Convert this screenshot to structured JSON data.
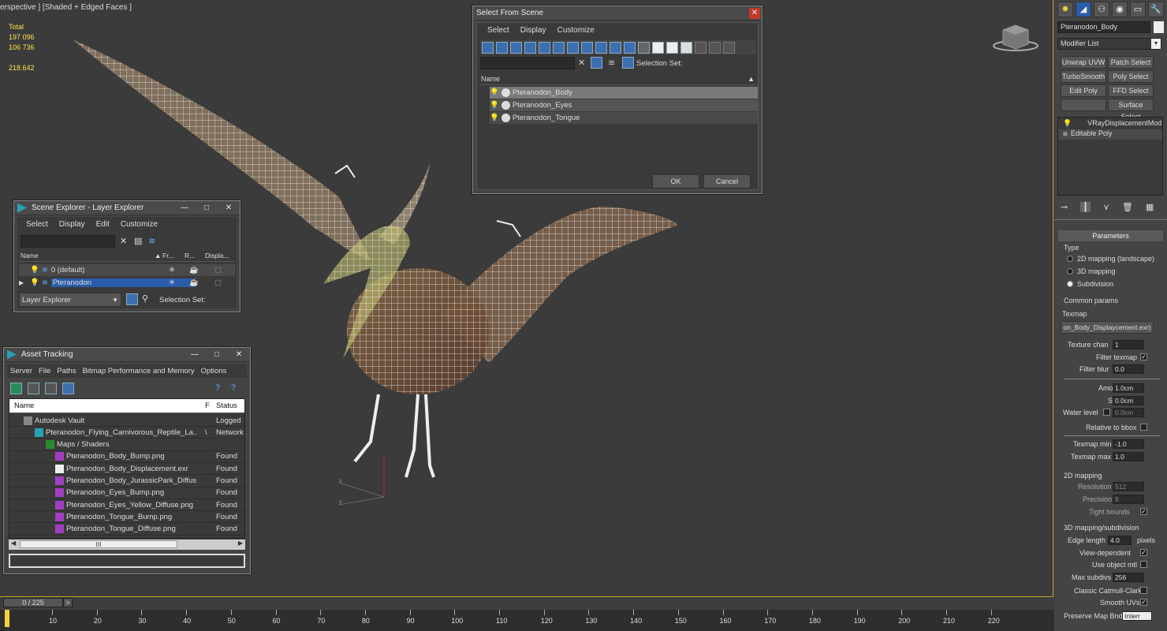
{
  "viewport": {
    "label": "erspective ] [Shaded + Edged Faces ]",
    "stats": {
      "total_label": "Total",
      "polys": "197 096",
      "verts": "106 736",
      "fps": "218.642"
    },
    "axis_x": "x",
    "axis_y": "y"
  },
  "select_dialog": {
    "title": "Select From Scene",
    "menu": [
      "Select",
      "Display",
      "Customize"
    ],
    "selection_set": "Selection Set:",
    "col_name": "Name",
    "items": [
      "Pteranodon_Body",
      "Pteranodon_Eyes",
      "Pteranodon_Tongue"
    ],
    "ok": "OK",
    "cancel": "Cancel"
  },
  "scene_explorer": {
    "title": "Scene Explorer - Layer Explorer",
    "menu": [
      "Select",
      "Display",
      "Edit",
      "Customize"
    ],
    "cols": [
      "Name",
      "Fr...",
      "R...",
      "Displa..."
    ],
    "rows": [
      "0 (default)",
      "Pteranodon"
    ],
    "dropdown": "Layer Explorer",
    "selection_set": "Selection Set:"
  },
  "asset_tracking": {
    "title": "Asset Tracking",
    "menu": [
      "Server",
      "File",
      "Paths",
      "Bitmap Performance and Memory",
      "Options"
    ],
    "cols": [
      "Name",
      "F",
      "Status"
    ],
    "rows": [
      {
        "name": "Autodesk Vault",
        "f": "",
        "status": "Logged"
      },
      {
        "name": "Pteranodon_Flying_Carnivorous_Reptile_La...",
        "f": "\\",
        "status": "Network"
      },
      {
        "name": "Maps / Shaders",
        "f": "",
        "status": ""
      },
      {
        "name": "Pteranodon_Body_Bump.png",
        "f": "",
        "status": "Found"
      },
      {
        "name": "Pteranodon_Body_Displacement.exr",
        "f": "",
        "status": "Found"
      },
      {
        "name": "Pteranodon_Body_JurassicPark_Diffus...",
        "f": "",
        "status": "Found"
      },
      {
        "name": "Pteranodon_Eyes_Bump.png",
        "f": "",
        "status": "Found"
      },
      {
        "name": "Pteranodon_Eyes_Yellow_Diffuse.png",
        "f": "",
        "status": "Found"
      },
      {
        "name": "Pteranodon_Tongue_Bump.png",
        "f": "",
        "status": "Found"
      },
      {
        "name": "Pteranodon_Tongue_Diffuse.png",
        "f": "",
        "status": "Found"
      }
    ],
    "scroll_mark": "III"
  },
  "command_panel": {
    "object_name": "Pteranodon_Body",
    "modifier_list": "Modifier List",
    "buttons": [
      "Unwrap UVW",
      "Patch Select",
      "TurboSmooth",
      "Poly Select",
      "Edit Poly",
      "FFD Select",
      "",
      "Surface Select"
    ],
    "stack": [
      "VRayDisplacementMod",
      "Editable Poly"
    ],
    "parameters": "Parameters",
    "type_label": "Type",
    "types": [
      "2D mapping (landscape)",
      "3D mapping",
      "Subdivision"
    ],
    "common_params": "Common params",
    "texmap_label": "Texmap",
    "texmap_value": "on_Body_Displaycement.exr)",
    "texture_chan": "Texture chan",
    "texture_chan_val": "1",
    "filter_texmap": "Filter texmap",
    "filter_blur": "Filter blur",
    "filter_blur_val": "0.0",
    "amount": "Amount",
    "amount_val": "1.0cm",
    "shift": "Shift",
    "shift_val": "0.0cm",
    "water_level": "Water level",
    "water_level_val": "0.0cm",
    "relative_bbox": "Relative to bbox",
    "texmap_min": "Texmap min",
    "texmap_min_val": "-1.0",
    "texmap_max": "Texmap max",
    "texmap_max_val": "1.0",
    "mapping2d": "2D mapping",
    "resolution": "Resolution",
    "resolution_val": "512",
    "precision": "Precision",
    "precision_val": "8",
    "tight_bounds": "Tight bounds",
    "mapping3d": "3D mapping/subdivision",
    "edge_length": "Edge length",
    "edge_length_val": "4.0",
    "pixels": "pixels",
    "view_dependent": "View-dependent",
    "use_object_mtl": "Use object mtl",
    "max_subdivs": "Max subdivs",
    "max_subdivs_val": "256",
    "catmull": "Classic Catmull-Clark",
    "smooth_uvs": "Smooth UVs",
    "preserve_map": "Preserve Map Bnd",
    "preserve_map_val": "Interr"
  },
  "timeline": {
    "frame": "0 / 225",
    "next": ">",
    "ticks": [
      "10",
      "20",
      "30",
      "40",
      "50",
      "60",
      "70",
      "80",
      "90",
      "100",
      "110",
      "120",
      "130",
      "140",
      "150",
      "160",
      "170",
      "180",
      "190",
      "200",
      "210",
      "220"
    ]
  }
}
